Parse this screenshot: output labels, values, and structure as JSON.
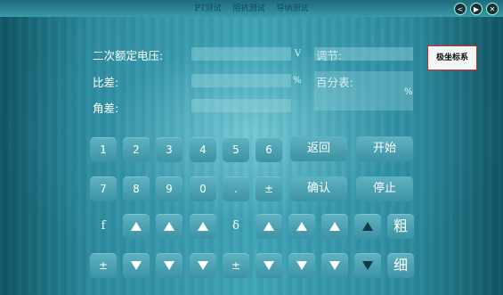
{
  "title_tabs": [
    "PT测试",
    "阻抗测试",
    "导纳测试"
  ],
  "window_buttons": {
    "back": "<",
    "forward": "▶",
    "close": "✕"
  },
  "labels": {
    "rated_voltage": "二次额定电压:",
    "ratio_error": "比差:",
    "angle_error": "角差:",
    "adjust": "调节:",
    "percent_meter": "百分表:"
  },
  "units": {
    "voltage": "V",
    "ratio_error": "%",
    "percent_meter": "%"
  },
  "fields": {
    "rated_voltage": "",
    "ratio_error": "",
    "angle_error": "",
    "adjust": "",
    "percent_meter": ""
  },
  "polar_button": "极坐标系",
  "keypad": {
    "row1": [
      "1",
      "2",
      "3",
      "4",
      "5",
      "6"
    ],
    "row2": [
      "7",
      "8",
      "9",
      "0",
      ".",
      "±"
    ],
    "back": "返回",
    "start": "开始",
    "confirm": "确认",
    "stop": "停止"
  },
  "adjust_row": {
    "f_label": "f",
    "delta_label": "δ",
    "coarse": "粗",
    "fine": "细",
    "pm_left": "±",
    "pm_mid": "±"
  }
}
